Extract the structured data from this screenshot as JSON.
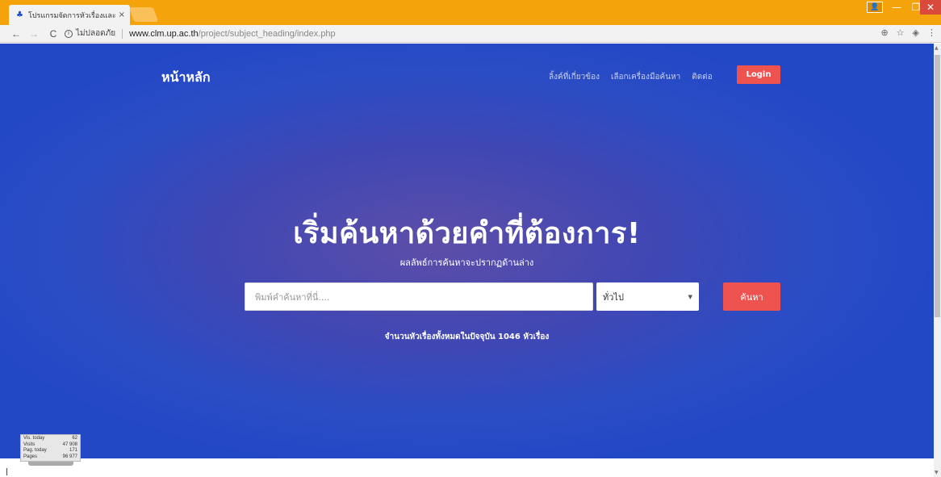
{
  "browser": {
    "tab_title": "โปรแกรมจัดการหัวเรื่องและห...",
    "tab_close": "×",
    "security_label": "ไม่ปลอดภัย",
    "url_domain": "www.clm.up.ac.th",
    "url_path": "/project/subject_heading/index.php",
    "icons": {
      "back": "←",
      "forward": "→",
      "reload": "C",
      "zoom": "🔍",
      "star": "☆",
      "extension": "⚙",
      "menu": "⋮",
      "minimize": "—",
      "maximize": "❐",
      "close": "✕"
    }
  },
  "nav": {
    "brand": "หน้าหลัก",
    "links": [
      "ลิ้งค์ที่เกี่ยวข้อง",
      "เลือกเครื่องมือค้นหา",
      "ติดต่อ"
    ],
    "login": "Login"
  },
  "hero": {
    "headline": "เริ่มค้นหาด้วยคำที่ต้องการ!",
    "subhead": "ผลลัพธ์การค้นหาจะปรากฏด้านล่าง",
    "search_placeholder": "พิมพ์คำค้นหาที่นี่....",
    "select_value": "ทั่วไป",
    "search_button": "ค้นหา",
    "count_text": "จำนวนหัวเรื่องทั้งหมดในปัจจุบัน 1046 หัวเรื่อง"
  },
  "counter": {
    "rows": [
      {
        "label": "Vis. today",
        "value": "62"
      },
      {
        "label": "Visits",
        "value": "47 908"
      },
      {
        "label": "Pag. today",
        "value": "171"
      },
      {
        "label": "Pages",
        "value": "96 977"
      }
    ]
  },
  "colors": {
    "titlebar": "#f5a30a",
    "hero_blue": "#2348c6",
    "accent_red": "#ef5350"
  }
}
